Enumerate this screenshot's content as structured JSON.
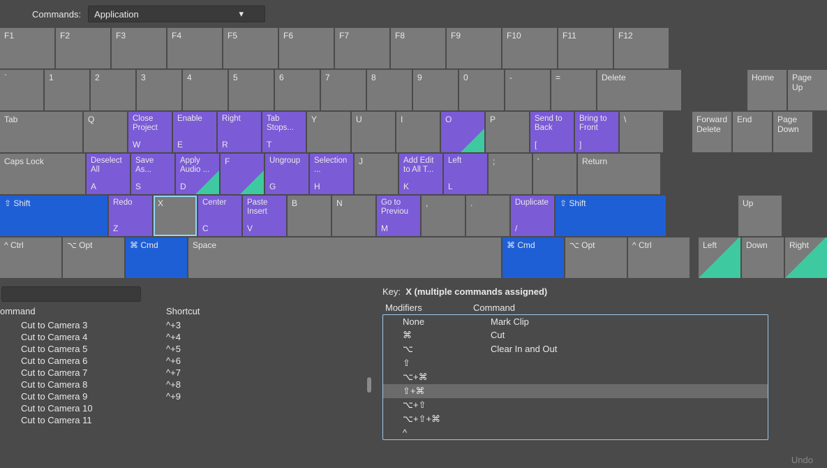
{
  "topbar": {
    "commands_label": "Commands:",
    "selected": "Application"
  },
  "keyboard": {
    "row_f": [
      "F1",
      "F2",
      "F3",
      "F4",
      "F5",
      "F6",
      "F7",
      "F8",
      "F9",
      "F10",
      "F11",
      "F12"
    ],
    "row_num": [
      "`",
      "1",
      "2",
      "3",
      "4",
      "5",
      "6",
      "7",
      "8",
      "9",
      "0",
      "-",
      "=",
      "Delete"
    ],
    "row_num_right": [
      "Home",
      "Page Up"
    ],
    "row_q": [
      {
        "k": "Tab"
      },
      {
        "k": "Q"
      },
      {
        "k": "W",
        "lbl": "Close Project",
        "c": "purple"
      },
      {
        "k": "E",
        "lbl": "Enable",
        "c": "purple"
      },
      {
        "k": "R",
        "lbl": "Right",
        "c": "purple"
      },
      {
        "k": "T",
        "lbl": "Tab Stops...",
        "c": "purple"
      },
      {
        "k": "Y"
      },
      {
        "k": "U"
      },
      {
        "k": "I"
      },
      {
        "k": "O",
        "c": "purple",
        "tri": true
      },
      {
        "k": "P"
      },
      {
        "k": "[",
        "lbl": "Send to Back",
        "c": "purple"
      },
      {
        "k": "]",
        "lbl": "Bring to Front",
        "c": "purple"
      },
      {
        "k": "\\"
      }
    ],
    "row_q_right": [
      {
        "k": "Forward Delete"
      },
      {
        "k": "End"
      },
      {
        "k": "Page Down"
      }
    ],
    "row_a": [
      {
        "k": "Caps Lock"
      },
      {
        "k": "A",
        "lbl": "Deselect All",
        "c": "purple"
      },
      {
        "k": "S",
        "lbl": "Save As...",
        "c": "purple"
      },
      {
        "k": "D",
        "lbl": "Apply Audio ...",
        "c": "purple",
        "tri": true
      },
      {
        "k": "F",
        "c": "purple",
        "tri": true
      },
      {
        "k": "G",
        "lbl": "Ungroup",
        "c": "purple"
      },
      {
        "k": "H",
        "lbl": "Selection ...",
        "c": "purple"
      },
      {
        "k": "J"
      },
      {
        "k": "K",
        "lbl": "Add Edit to All T...",
        "c": "purple"
      },
      {
        "k": "L",
        "lbl": "Left",
        "c": "purple"
      },
      {
        "k": ";"
      },
      {
        "k": "'"
      },
      {
        "k": "Return"
      }
    ],
    "row_z": [
      {
        "k": "⇧ Shift",
        "c": "blue"
      },
      {
        "k": "Z",
        "lbl": "Redo",
        "c": "purple"
      },
      {
        "k": "X",
        "sel": true
      },
      {
        "k": "C",
        "lbl": "Center",
        "c": "purple"
      },
      {
        "k": "V",
        "lbl": "Paste Insert",
        "c": "purple"
      },
      {
        "k": "B"
      },
      {
        "k": "N"
      },
      {
        "k": "M",
        "lbl": "Go to Previou",
        "c": "purple"
      },
      {
        "k": ","
      },
      {
        "k": "."
      },
      {
        "k": "/",
        "lbl": "Duplicate",
        "c": "purple"
      },
      {
        "k": "⇧ Shift",
        "c": "blue"
      }
    ],
    "row_z_right": [
      {
        "k": "Up"
      }
    ],
    "row_mod": [
      {
        "k": "^ Ctrl"
      },
      {
        "k": "⌥ Opt"
      },
      {
        "k": "⌘ Cmd",
        "c": "blue"
      },
      {
        "k": "Space"
      },
      {
        "k": "⌘ Cmd",
        "c": "blue"
      },
      {
        "k": "⌥ Opt"
      },
      {
        "k": "^ Ctrl"
      }
    ],
    "row_mod_right": [
      {
        "k": "Left",
        "tri": true
      },
      {
        "k": "Down"
      },
      {
        "k": "Right",
        "tri": true
      }
    ]
  },
  "bottom": {
    "key_info_prefix": "Key:",
    "key_info_value": "X (multiple commands assigned)",
    "command_header": "Command",
    "shortcut_header": "Shortcut",
    "command_list_header": "ommand",
    "rows": [
      {
        "cmd": "Cut to Camera 3",
        "sc": "^+3"
      },
      {
        "cmd": "Cut to Camera 4",
        "sc": "^+4"
      },
      {
        "cmd": "Cut to Camera 5",
        "sc": "^+5"
      },
      {
        "cmd": "Cut to Camera 6",
        "sc": "^+6"
      },
      {
        "cmd": "Cut to Camera 7",
        "sc": "^+7"
      },
      {
        "cmd": "Cut to Camera 8",
        "sc": "^+8"
      },
      {
        "cmd": "Cut to Camera 9",
        "sc": "^+9"
      },
      {
        "cmd": "Cut to Camera 10",
        "sc": ""
      },
      {
        "cmd": "Cut to Camera 11",
        "sc": ""
      }
    ],
    "modifiers_header": "Modifiers",
    "command2_header": "Command",
    "mods": [
      {
        "m": "None",
        "c": "Mark Clip"
      },
      {
        "m": "⌘",
        "c": "Cut"
      },
      {
        "m": "⌥",
        "c": "Clear In and Out"
      },
      {
        "m": "⇧",
        "c": ""
      },
      {
        "m": "⌥+⌘",
        "c": ""
      },
      {
        "m": "⇧+⌘",
        "c": "",
        "sel": true
      },
      {
        "m": "⌥+⇧",
        "c": ""
      },
      {
        "m": "⌥+⇧+⌘",
        "c": ""
      },
      {
        "m": "^",
        "c": ""
      }
    ],
    "undo_label": "Undo"
  }
}
